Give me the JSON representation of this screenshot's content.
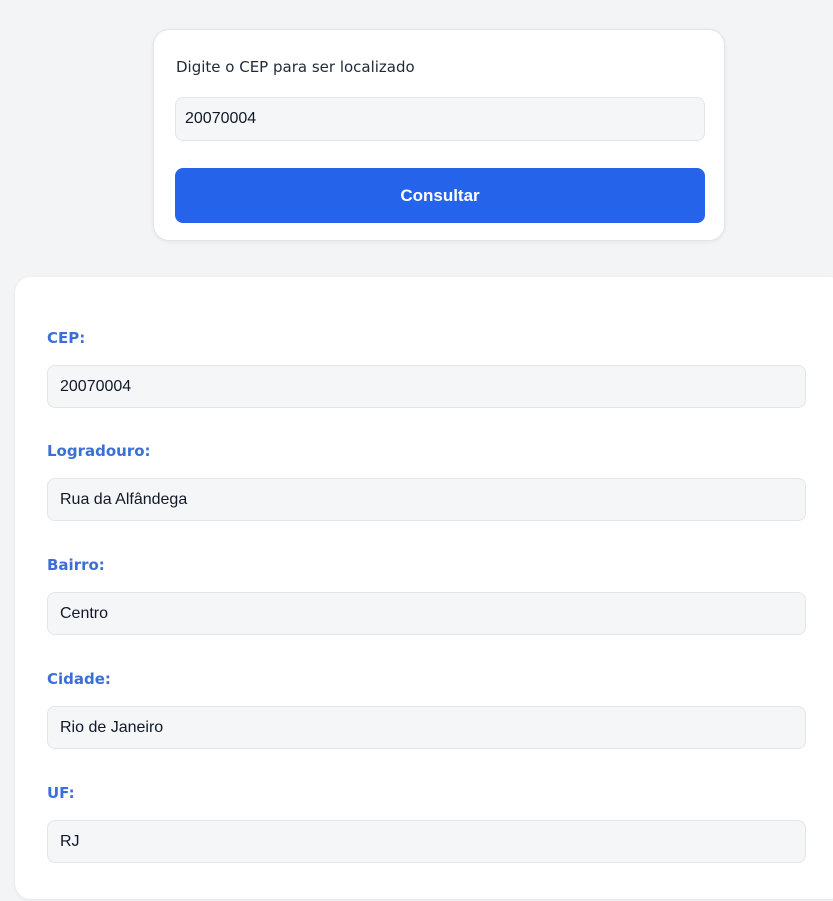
{
  "search": {
    "label": "Digite o CEP para ser localizado",
    "input_value": "20070004",
    "button_label": "Consultar"
  },
  "result": {
    "fields": [
      {
        "label": "CEP:",
        "value": "20070004"
      },
      {
        "label": "Logradouro:",
        "value": "Rua da Alfândega"
      },
      {
        "label": "Bairro:",
        "value": "Centro"
      },
      {
        "label": "Cidade:",
        "value": "Rio de Janeiro"
      },
      {
        "label": "UF:",
        "value": "RJ"
      }
    ]
  },
  "colors": {
    "accent": "#2563eb",
    "label_blue": "#3b6fd8",
    "field_bg": "#f5f6f8",
    "page_bg": "#f3f4f6"
  }
}
